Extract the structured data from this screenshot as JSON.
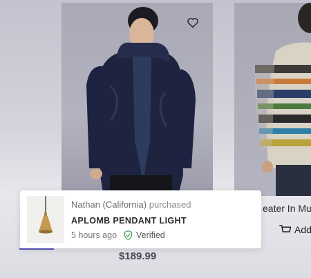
{
  "product_card_1": {
    "price": "$189.99"
  },
  "product_card_2": {
    "title_partial": "eater In Mu",
    "add_button_label": "Add"
  },
  "purchase_popup": {
    "buyer": "Nathan (California)",
    "action": "purchased",
    "product_name": "APLOMB PENDANT LIGHT",
    "time_ago": "5 hours ago",
    "verified_label": "Verified"
  },
  "colors": {
    "accent": "#5b55b6",
    "verified": "#3d9b4f"
  },
  "icons": [
    "heart-icon",
    "cart-icon",
    "verified-shield-icon"
  ]
}
